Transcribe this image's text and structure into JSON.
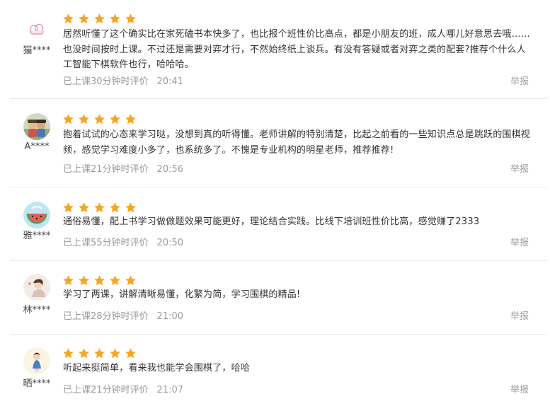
{
  "reviews": [
    {
      "user": "猫****",
      "stars": 5,
      "content": "居然听懂了这个确实比在家死磕书本快多了，也比报个班性价比高点，都是小朋友的班，成人哪儿好意思去哦……也没时间按时上课。不过还是需要对弈才行，不然始终纸上谈兵。有没有答疑或者对弈之类的配套?推荐个什么人工智能下棋软件也行，哈哈哈。",
      "meta": "已上课30分钟时评价",
      "time": "20:41",
      "report": "举报",
      "avatar_icon": "cloud-icon"
    },
    {
      "user": "A****",
      "stars": 5,
      "content": "抱着试试的心态来学习哒，没想到真的听得懂。老师讲解的特别清楚，比起之前看的一些知识点总是跳跃的围棋视频，感觉学习难度小多了，也系统多了。不愧是专业机构的明星老师，推荐推荐!",
      "meta": "已上课21分钟时评价",
      "time": "20:56",
      "report": "举报",
      "avatar_icon": "photo-avatar-icon"
    },
    {
      "user": "雅****",
      "stars": 5,
      "content": "通俗易懂，配上书学习做做题效果可能更好，理论结合实践。比线下培训班性价比高，感觉赚了2333",
      "meta": "已上课55分钟时评价",
      "time": "20:50",
      "report": "举报",
      "avatar_icon": "watermelon-icon"
    },
    {
      "user": "林****",
      "stars": 5,
      "content": "学习了两课，讲解清晰易懂，化繁为简，学习围棋的精品!",
      "meta": "已上课28分钟时评价",
      "time": "21:00",
      "report": "举报",
      "avatar_icon": "girl-avatar-icon"
    },
    {
      "user": "晒****",
      "stars": 5,
      "content": "听起来挺简单，看来我也能学会围棋了，哈哈",
      "meta": "已上课21分钟时评价",
      "time": "21:07",
      "report": "举报",
      "avatar_icon": "cartoon-avatar-icon"
    }
  ],
  "colors": {
    "star": "#f5a623",
    "meta_text": "#9b9b9b",
    "divider": "#e8e8e8"
  }
}
